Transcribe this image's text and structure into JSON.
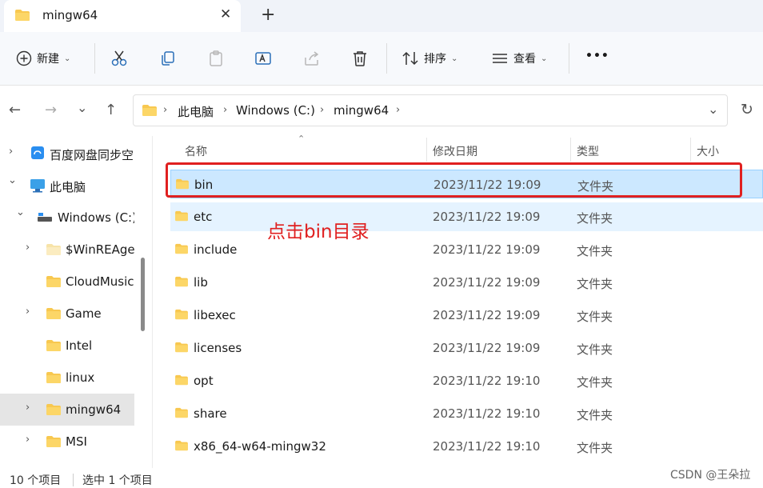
{
  "window": {
    "tab_title": "mingw64",
    "close_glyph": "✕",
    "new_tab_glyph": "+"
  },
  "toolbar": {
    "new_label": "新建",
    "sort_label": "排序",
    "view_label": "查看",
    "more_glyph": "•••"
  },
  "address": {
    "crumbs": [
      "此电脑",
      "Windows (C:)",
      "mingw64"
    ]
  },
  "sidebar": {
    "items": [
      {
        "label": "百度网盘同步空",
        "chev": "›"
      },
      {
        "label": "此电脑",
        "chev": "⌄"
      },
      {
        "label": "Windows (C:)",
        "chev": "⌄"
      },
      {
        "label": "$WinREAge",
        "chev": "›"
      },
      {
        "label": "CloudMusic",
        "chev": ""
      },
      {
        "label": "Game",
        "chev": "›"
      },
      {
        "label": "Intel",
        "chev": ""
      },
      {
        "label": "linux",
        "chev": ""
      },
      {
        "label": "mingw64",
        "chev": "›"
      },
      {
        "label": "MSI",
        "chev": "›"
      }
    ]
  },
  "columns": {
    "name": "名称",
    "modified": "修改日期",
    "type": "类型",
    "size": "大小"
  },
  "files": [
    {
      "name": "bin",
      "date": "2023/11/22 19:09",
      "type": "文件夹"
    },
    {
      "name": "etc",
      "date": "2023/11/22 19:09",
      "type": "文件夹"
    },
    {
      "name": "include",
      "date": "2023/11/22 19:09",
      "type": "文件夹"
    },
    {
      "name": "lib",
      "date": "2023/11/22 19:09",
      "type": "文件夹"
    },
    {
      "name": "libexec",
      "date": "2023/11/22 19:09",
      "type": "文件夹"
    },
    {
      "name": "licenses",
      "date": "2023/11/22 19:09",
      "type": "文件夹"
    },
    {
      "name": "opt",
      "date": "2023/11/22 19:10",
      "type": "文件夹"
    },
    {
      "name": "share",
      "date": "2023/11/22 19:10",
      "type": "文件夹"
    },
    {
      "name": "x86_64-w64-mingw32",
      "date": "2023/11/22 19:10",
      "type": "文件夹"
    }
  ],
  "annotation": "点击bin目录",
  "status": {
    "count": "10 个项目",
    "selected": "选中 1 个项目"
  },
  "watermark": "CSDN @王朵拉",
  "colors": {
    "selection": "#cce8ff",
    "annotation": "#e02020",
    "folder": "#f8c850"
  }
}
